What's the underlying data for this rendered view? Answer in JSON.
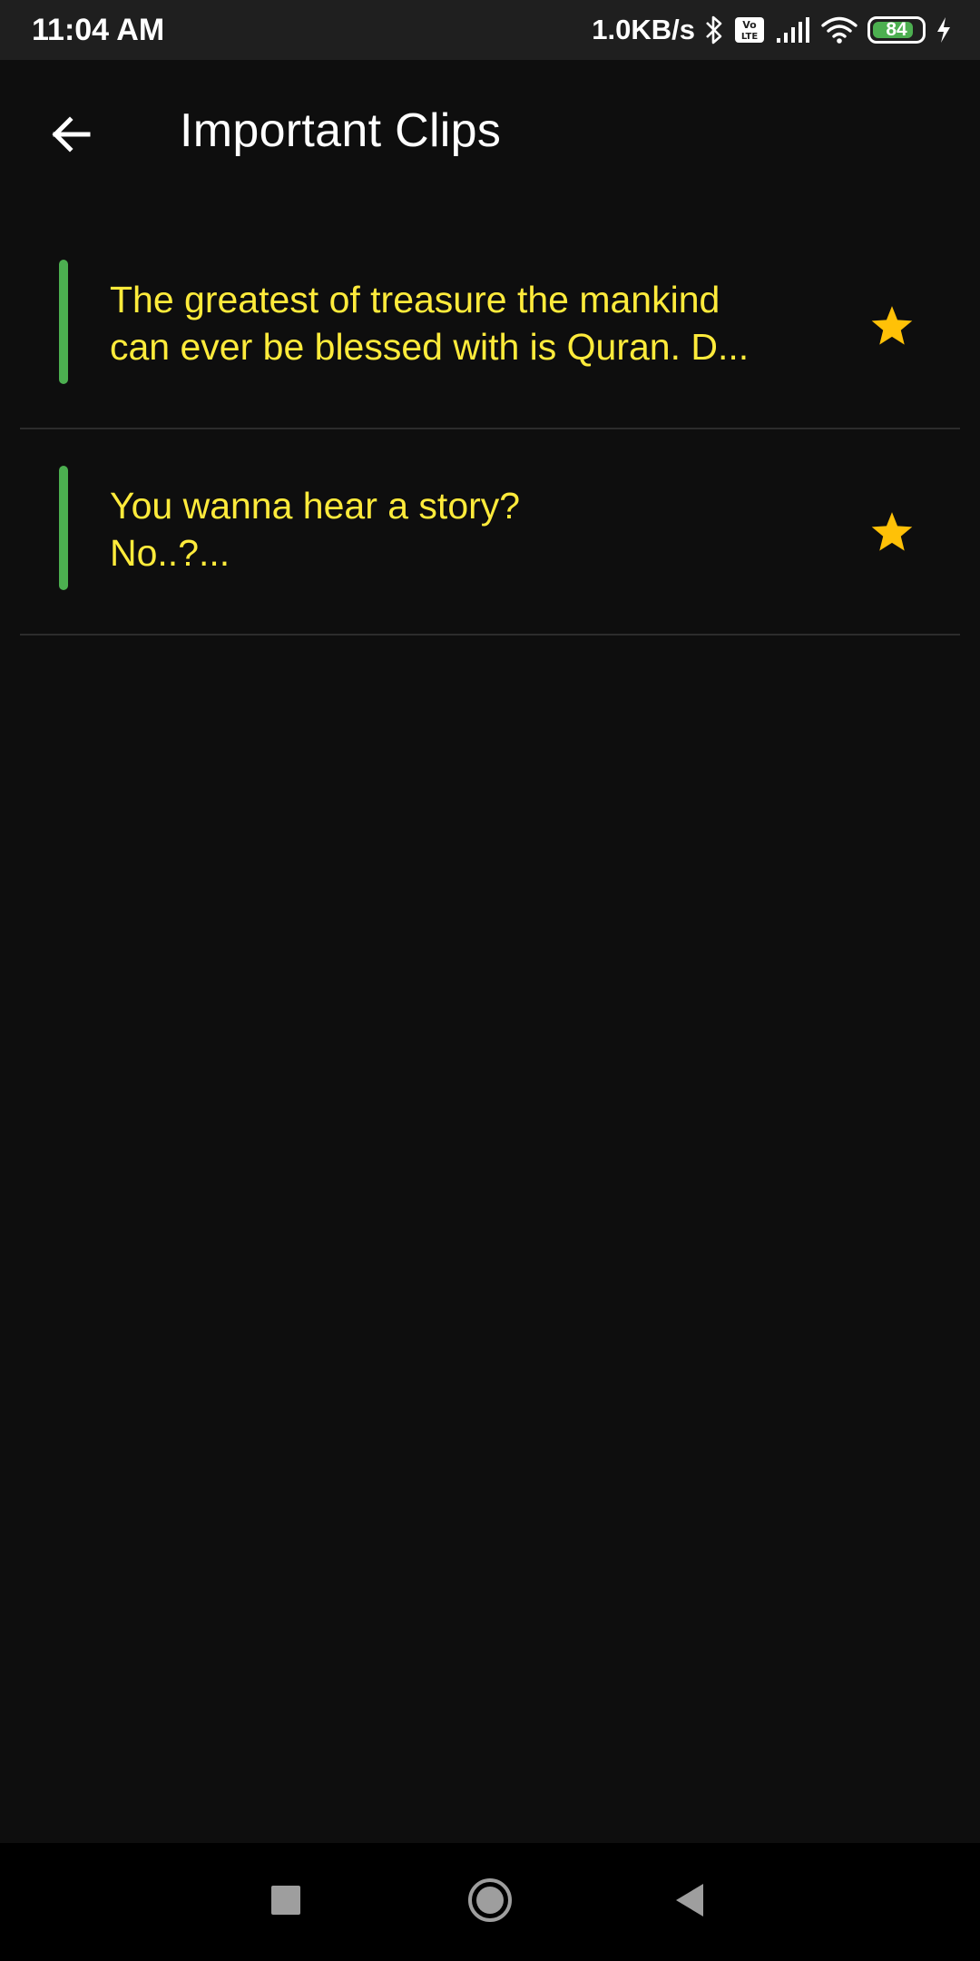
{
  "status_bar": {
    "time": "11:04 AM",
    "network_speed": "1.0KB/s",
    "battery_level": "84",
    "battery_fraction": 0.84,
    "icons": [
      "bluetooth-icon",
      "volte-icon",
      "signal-icon",
      "wifi-icon",
      "battery-icon",
      "charging-icon"
    ]
  },
  "app_bar": {
    "title": "Important Clips",
    "back_icon": "arrow-left-icon"
  },
  "clips": [
    {
      "text": "The greatest of treasure the mankind\ncan ever be blessed with is Quran. D...",
      "starred": true
    },
    {
      "text": "You wanna hear a story?\nNo..?...",
      "starred": true
    }
  ],
  "colors": {
    "background": "#0e0e0e",
    "accent_green": "#4caf50",
    "clip_text": "#ffeb3b",
    "star": "#ffc107",
    "divider": "#2c2c2c"
  },
  "nav_bar": {
    "icons": [
      "recents-icon",
      "home-icon",
      "back-triangle-icon"
    ]
  }
}
